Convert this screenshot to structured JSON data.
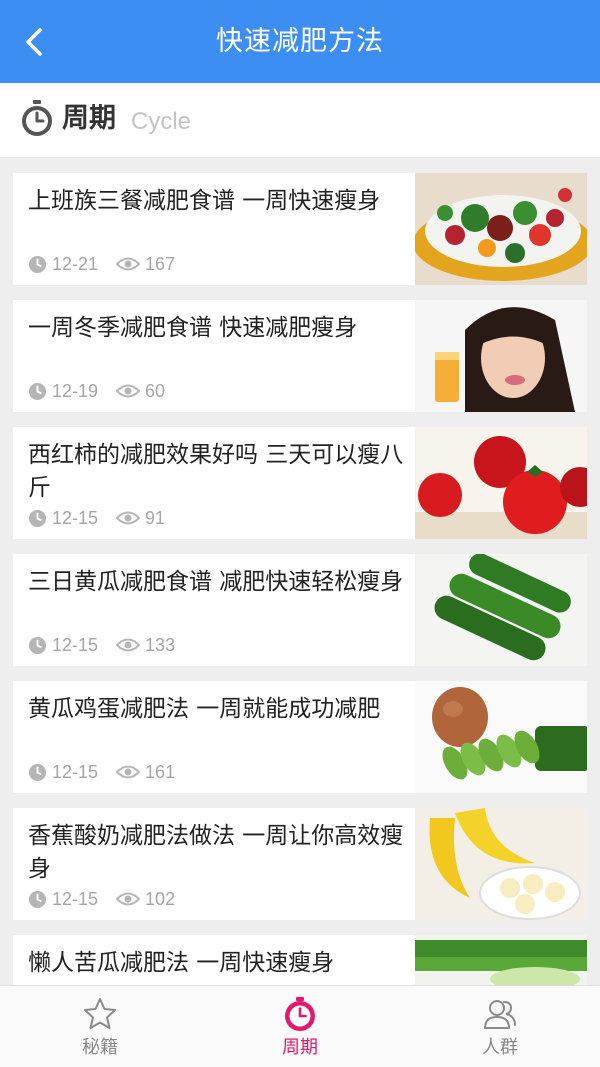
{
  "header": {
    "title": "快速减肥方法",
    "back_icon": "chevron-left-icon"
  },
  "section": {
    "title": "周期",
    "subtitle": "Cycle",
    "icon": "stopwatch-icon"
  },
  "articles": [
    {
      "title": "上班族三餐减肥食谱 一周快速瘦身",
      "date": "12-21",
      "views": "167",
      "thumb": "salad-image"
    },
    {
      "title": "一周冬季减肥食谱 快速减肥瘦身",
      "date": "12-19",
      "views": "60",
      "thumb": "woman-juice-image"
    },
    {
      "title": "西红柿的减肥效果好吗 三天可以瘦八斤",
      "date": "12-15",
      "views": "91",
      "thumb": "tomatoes-image"
    },
    {
      "title": "三日黄瓜减肥食谱 减肥快速轻松瘦身",
      "date": "12-15",
      "views": "133",
      "thumb": "cucumbers-image"
    },
    {
      "title": "黄瓜鸡蛋减肥法 一周就能成功减肥",
      "date": "12-15",
      "views": "161",
      "thumb": "egg-cucumber-image"
    },
    {
      "title": "香蕉酸奶减肥法做法 一周让你高效瘦身",
      "date": "12-15",
      "views": "102",
      "thumb": "banana-yogurt-image"
    },
    {
      "title": "懒人苦瓜减肥法 一周快速瘦身",
      "date": "",
      "views": "",
      "thumb": "bitter-melon-image"
    }
  ],
  "tabs": [
    {
      "label": "秘籍",
      "icon": "star-icon",
      "active": false
    },
    {
      "label": "周期",
      "icon": "stopwatch-icon",
      "active": true
    },
    {
      "label": "人群",
      "icon": "people-icon",
      "active": false
    }
  ],
  "colors": {
    "header": "#3d8ef2",
    "active_tab": "#e5186d",
    "meta_text": "#a5a5a5"
  }
}
